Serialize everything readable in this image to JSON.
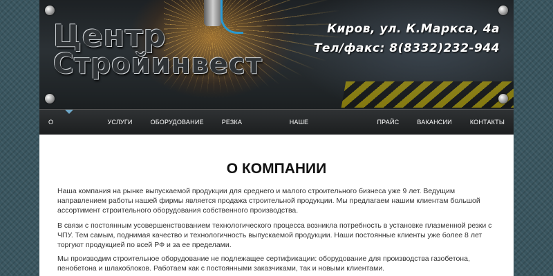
{
  "header": {
    "logo_line1": "Центр",
    "logo_line2": "Стройинвест",
    "address": "Киров, ул. К.Маркса, 4а",
    "phone": "Тел/факс: 8(8332)232-944"
  },
  "nav": {
    "items": [
      {
        "label": "О КОМПАНИИ",
        "active": true
      },
      {
        "label": "УСЛУГИ"
      },
      {
        "label": "ОБОРУДОВАНИЕ"
      },
      {
        "label": "РЕЗКА МЕТАЛЛА"
      },
      {
        "label": "НАШЕ ПРОИЗВОДСТВО"
      },
      {
        "label": "ПРАЙС"
      },
      {
        "label": "ВАКАНСИИ"
      },
      {
        "label": "КОНТАКТЫ"
      }
    ]
  },
  "content": {
    "title": "О КОМПАНИИ",
    "paragraphs": [
      "Наша компания на рынке выпускаемой продукции для среднего и малого   строительного бизнеса уже 9 лет. Ведущим направлением работы нашей фирмы является продажа строительной продукции. Мы предлагаем нашим клиентам большой ассортимент строительного оборудования собственного производства.",
      "В связи с постоянным усовершенствованием технологического процесса возникла потребность в установке плазменной резки с ЧПУ. Тем самым, поднимая качество и технологичность выпускаемой продукции. Наши постоянные клиенты уже более 8 лет торгуют  продукцией  по всей РФ и за ее пределами.",
      "Мы производим строительное оборудование не подлежащее сертификации: оборудование для производства газобетона, пенобетона и шлакоблоков. Работаем как с постоянными заказчиками, так и новыми клиентами."
    ]
  }
}
